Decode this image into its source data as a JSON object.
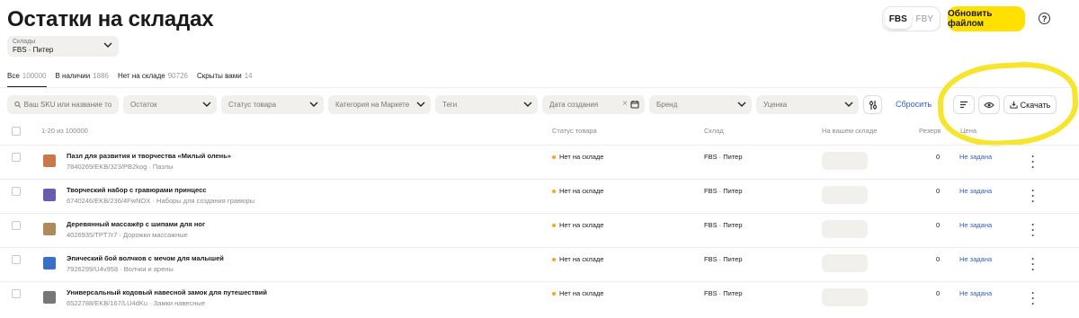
{
  "page": {
    "title": "Остатки на складах"
  },
  "header": {
    "mode_fbs": "FBS",
    "mode_fby": "FBY",
    "update_button": "Обновить файлом",
    "help_icon": "?"
  },
  "warehouse_select": {
    "label": "Склады",
    "value": "FBS · Питер"
  },
  "tabs": [
    {
      "label": "Все",
      "count": "100000",
      "active": true
    },
    {
      "label": "В наличии",
      "count": "1886"
    },
    {
      "label": "Нет на складе",
      "count": "90726"
    },
    {
      "label": "Скрыты вами",
      "count": "14"
    }
  ],
  "filters": {
    "search_placeholder": "Ваш SKU или название товара",
    "stock": "Остаток",
    "status": "Статус товара",
    "category": "Категория на Маркете",
    "tags": "Теги",
    "created_date": "Дата создания",
    "brand": "Бренд",
    "rating": "Уценка",
    "reset": "Сбросить",
    "download": "Скачать"
  },
  "table": {
    "range": "1-20 из 100000",
    "columns": {
      "status": "Статус товара",
      "warehouse": "Склад",
      "your_stock": "На вашем складе",
      "reserve": "Резерв",
      "price": "Цена"
    },
    "rows": [
      {
        "name": "Пазл для развития и творчества «Милый олень»",
        "sku": "7840269/EKB/323/PB2kog · Пазлы",
        "status": "Нет на складе",
        "warehouse": "FBS · Питер",
        "reserve": "0",
        "price": "Не задана",
        "thumb_color": "#c9784a"
      },
      {
        "name": "Творческий набор с гравюрами принцесс",
        "sku": "6740246/EKB/236/4FwNOX · Наборы для создания гравюры",
        "status": "Нет на складе",
        "warehouse": "FBS · Питер",
        "reserve": "0",
        "price": "Не задана",
        "thumb_color": "#6a5bb0"
      },
      {
        "name": "Деревянный массажёр с шипами для ног",
        "sku": "4026935/TPT7r7 · Дорожки массажные",
        "status": "Нет на складе",
        "warehouse": "FBS · Питер",
        "reserve": "0",
        "price": "Не задана",
        "thumb_color": "#b08a5a"
      },
      {
        "name": "Эпический бой волчков с мечом для малышей",
        "sku": "7926299/U4v958 · Волчки и арены",
        "status": "Нет на складе",
        "warehouse": "FBS · Питер",
        "reserve": "0",
        "price": "Не задана",
        "thumb_color": "#3b6fc4"
      },
      {
        "name": "Универсальный кодовый навесной замок для путешествий",
        "sku": "6522788/EKB/167/LU4dKu · Замки навесные",
        "status": "Нет на складе",
        "warehouse": "FBS · Питер",
        "reserve": "0",
        "price": "Не задана",
        "thumb_color": "#777777"
      }
    ]
  },
  "colors": {
    "accent_yellow": "#ffe000",
    "link_blue": "#2a5bd7",
    "status_orange": "#f5a623"
  }
}
